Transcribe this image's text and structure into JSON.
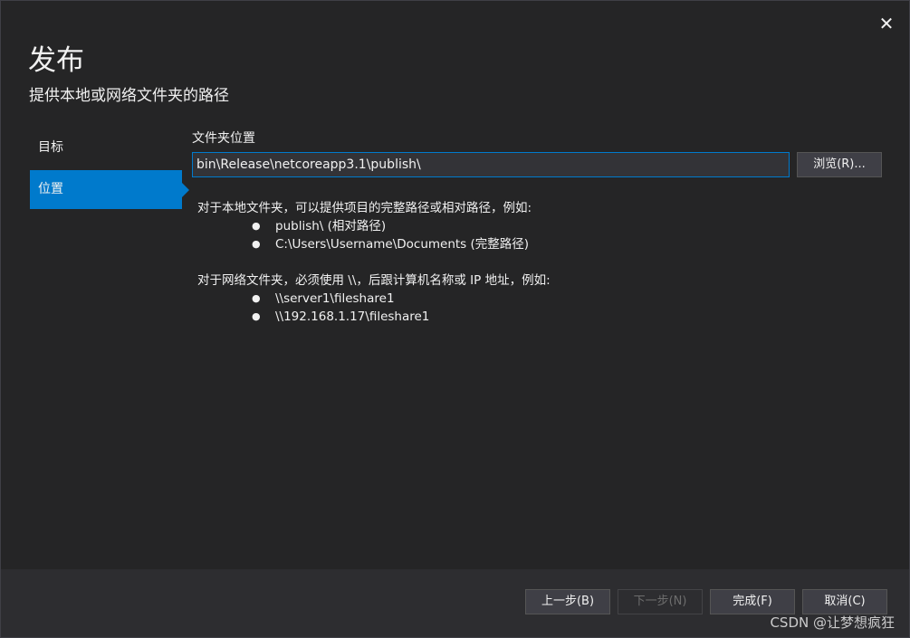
{
  "dialog": {
    "title": "发布",
    "subtitle": "提供本地或网络文件夹的路径",
    "close_glyph": "✕"
  },
  "nav": {
    "items": [
      {
        "label": "目标",
        "active": false
      },
      {
        "label": "位置",
        "active": true
      }
    ]
  },
  "location": {
    "folder_label": "文件夹位置",
    "path_value": "bin\\Release\\netcoreapp3.1\\publish\\",
    "browse_label": "浏览(R)..."
  },
  "help": {
    "local_intro": "对于本地文件夹，可以提供项目的完整路径或相对路径，例如:",
    "local_examples": [
      "publish\\ (相对路径)",
      "C:\\Users\\Username\\Documents (完整路径)"
    ],
    "network_intro": "对于网络文件夹，必须使用 \\\\，后跟计算机名称或 IP 地址，例如:",
    "network_examples": [
      "\\\\server1\\fileshare1",
      "\\\\192.168.1.17\\fileshare1"
    ]
  },
  "footer": {
    "prev_label": "上一步(B)",
    "next_label": "下一步(N)",
    "finish_label": "完成(F)",
    "cancel_label": "取消(C)"
  },
  "watermark": "CSDN @让梦想疯狂",
  "colors": {
    "accent": "#007acc",
    "background": "#252526",
    "footer": "#2d2d30"
  }
}
